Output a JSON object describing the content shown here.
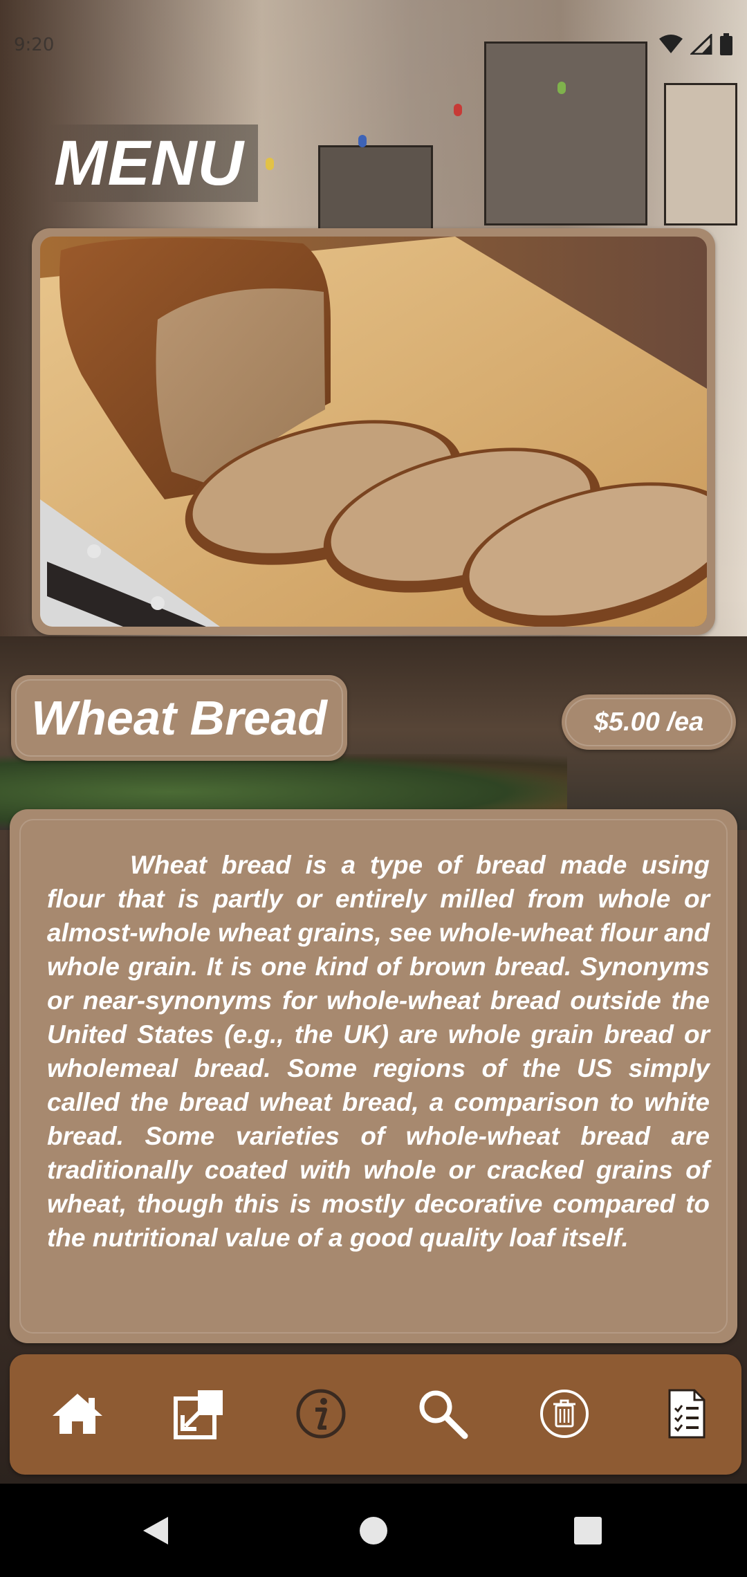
{
  "status_bar": {
    "time": "9:20",
    "icons": [
      "wifi-icon",
      "signal-icon",
      "battery-icon"
    ]
  },
  "header": {
    "title": "MENU"
  },
  "item": {
    "image_alt": "wheat-bread-photo",
    "name": "Wheat Bread",
    "price": "$5.00 /ea",
    "description": "Wheat bread is a type of bread made using flour that is partly or entirely milled from whole or almost-whole wheat grains, see whole-wheat flour and whole grain. It is one kind of brown bread. Synonyms or near-synonyms for whole-wheat bread outside the United States (e.g., the UK) are whole grain bread or wholemeal bread. Some regions of the US simply called the bread wheat bread, a comparison to white bread. Some varieties of whole-wheat bread are traditionally coated with whole or cracked grains of wheat, though this is mostly decorative compared to the nutritional value of a good quality loaf itself."
  },
  "toolbar": {
    "items": [
      {
        "icon": "home-icon"
      },
      {
        "icon": "open-external-icon"
      },
      {
        "icon": "info-icon"
      },
      {
        "icon": "search-icon"
      },
      {
        "icon": "trash-icon"
      },
      {
        "icon": "checklist-icon"
      }
    ]
  },
  "navbar": {
    "items": [
      {
        "icon": "back-icon"
      },
      {
        "icon": "home-circle-icon"
      },
      {
        "icon": "recents-icon"
      }
    ]
  },
  "colors": {
    "card": "#a7896f",
    "toolbar": "#8e5b33",
    "text": "#ffffff",
    "navbar": "#000000"
  }
}
